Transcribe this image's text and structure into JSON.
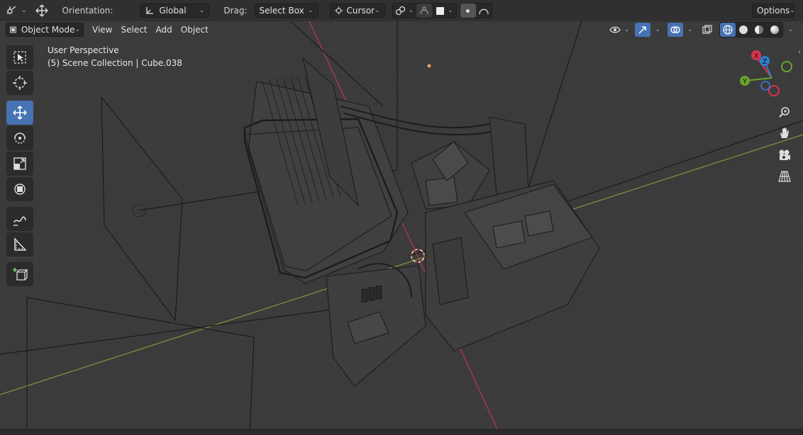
{
  "header": {
    "orientation_label": "Orientation:",
    "orientation_value": "Global",
    "drag_label": "Drag:",
    "drag_value": "Select Box",
    "pivot_value": "Cursor",
    "options_label": "Options"
  },
  "subheader": {
    "mode_value": "Object Mode",
    "menu": [
      "View",
      "Select",
      "Add",
      "Object"
    ]
  },
  "overlay": {
    "perspective": "User Perspective",
    "collection": "(5) Scene Collection | Cube.038"
  },
  "gizmo": {
    "x_label": "X",
    "y_label": "Y",
    "z_label": "Z",
    "x_color": "#d9344e",
    "y_color": "#6aa32c",
    "z_color": "#2f7fd1"
  },
  "colors": {
    "accent": "#4772b3",
    "x_axis": "#c5364b",
    "y_axis": "#7ea43c",
    "cursor": "#d63c3c"
  },
  "toolbar_tools": [
    "select-box",
    "cursor",
    "move",
    "rotate",
    "scale",
    "transform",
    "annotate",
    "measure",
    "add-cube"
  ]
}
